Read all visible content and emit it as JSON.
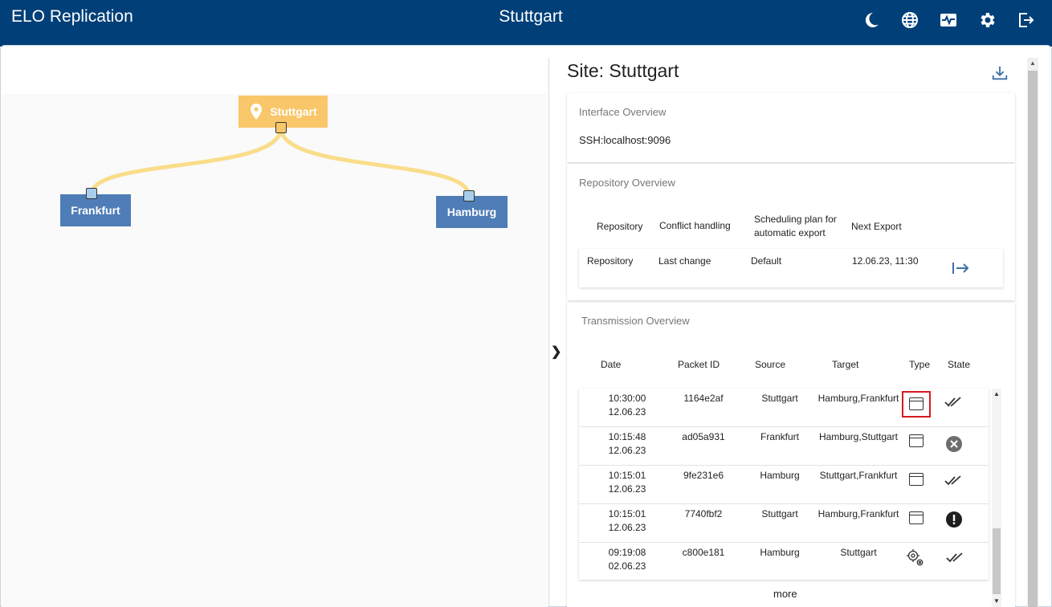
{
  "header": {
    "app_title": "ELO Replication",
    "site_title": "Stuttgart",
    "icons": [
      "moon-icon",
      "globe-icon",
      "monitor-pulse-icon",
      "gear-icon",
      "logout-icon"
    ]
  },
  "graph": {
    "nodes": [
      {
        "name": "Stuttgart",
        "color": "#f9c66a",
        "icon": "location-pin-icon"
      },
      {
        "name": "Frankfurt",
        "color": "#4f7db7"
      },
      {
        "name": "Hamburg",
        "color": "#4f7db7"
      }
    ],
    "edge_color": "#f9dd8a"
  },
  "panel": {
    "title": "Site: Stuttgart",
    "interface": {
      "title": "Interface Overview",
      "value": "SSH:localhost:9096"
    },
    "repository": {
      "title": "Repository Overview",
      "headers": [
        "Repository",
        "Conflict handling",
        "Scheduling plan for automatic export",
        "Next Export"
      ],
      "row": {
        "repository": "Repository",
        "conflict": "Last change",
        "schedule": "Default",
        "next_export": "12.06.23, 11:30"
      }
    },
    "transmission": {
      "title": "Transmission Overview",
      "headers": [
        "Date",
        "Packet ID",
        "Source",
        "Target",
        "Type",
        "State"
      ],
      "rows": [
        {
          "time": "10:30:00",
          "date": "12.06.23",
          "packet": "1164e2af",
          "source": "Stuttgart",
          "target": "Hamburg,Frankfurt",
          "type": "window-icon",
          "state": "double-check-icon"
        },
        {
          "time": "10:15:48",
          "date": "12.06.23",
          "packet": "ad05a931",
          "source": "Frankfurt",
          "target": "Hamburg,Stuttgart",
          "type": "window-icon",
          "state": "error-circle-icon"
        },
        {
          "time": "10:15:01",
          "date": "12.06.23",
          "packet": "9fe231e6",
          "source": "Hamburg",
          "target": "Stuttgart,Frankfurt",
          "type": "window-icon",
          "state": "double-check-icon"
        },
        {
          "time": "10:15:01",
          "date": "12.06.23",
          "packet": "7740fbf2",
          "source": "Stuttgart",
          "target": "Hamburg,Frankfurt",
          "type": "window-icon",
          "state": "warning-circle-icon"
        },
        {
          "time": "09:19:08",
          "date": "02.06.23",
          "packet": "c800e181",
          "source": "Hamburg",
          "target": "Stuttgart",
          "type": "gears-icon",
          "state": "double-check-icon"
        }
      ],
      "more_label": "more"
    }
  }
}
